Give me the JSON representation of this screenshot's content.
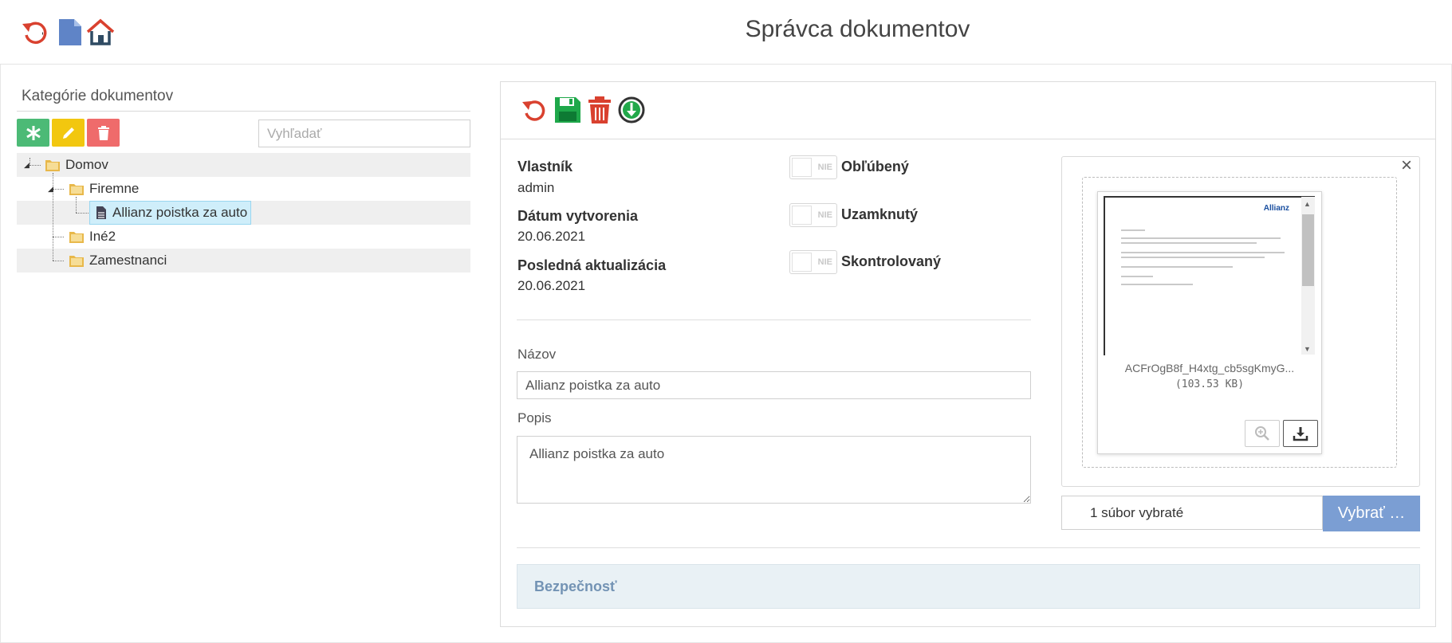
{
  "header": {
    "title": "Správca dokumentov",
    "icons": [
      "refresh-icon",
      "document-icon",
      "home-icon"
    ]
  },
  "categories": {
    "title": "Kategórie dokumentov",
    "search_placeholder": "Vyhľadať",
    "buttons": [
      "add-category-button",
      "edit-category-button",
      "delete-category-button"
    ],
    "tree": [
      {
        "label": "Domov",
        "level": 0,
        "type": "folder"
      },
      {
        "label": "Firemne",
        "level": 1,
        "type": "folder"
      },
      {
        "label": "Allianz poistka za auto",
        "level": 2,
        "type": "document",
        "selected": true
      },
      {
        "label": "Iné2",
        "level": 1,
        "type": "folder"
      },
      {
        "label": "Zamestnanci",
        "level": 1,
        "type": "folder"
      }
    ]
  },
  "toolbar": {
    "icons": [
      "reset-icon",
      "save-icon",
      "trash-icon",
      "download-icon"
    ]
  },
  "details": {
    "owner_label": "Vlastník",
    "owner_value": "admin",
    "created_label": "Dátum vytvorenia",
    "created_value": "20.06.2021",
    "updated_label": "Posledná aktualizácia",
    "updated_value": "20.06.2021"
  },
  "toggles": [
    {
      "state": "NIE",
      "label": "Obľúbený"
    },
    {
      "state": "NIE",
      "label": "Uzamknutý"
    },
    {
      "state": "NIE",
      "label": "Skontrolovaný"
    }
  ],
  "form": {
    "name_label": "Názov",
    "name_value": "Allianz poistka za auto",
    "desc_label": "Popis",
    "desc_value": "Allianz poistka za auto"
  },
  "file": {
    "brand": "Allianz",
    "name": "ACFrOgB8f_H4xtg_cb5sgKmyG...",
    "size": "(103.53 KB)",
    "caption": "1 súbor vybraté",
    "pick_label": "Vybrať …",
    "close_label": "×"
  },
  "security": {
    "label": "Bezpečnosť"
  },
  "colors": {
    "green": "#4cba76",
    "yellow": "#f2c70f",
    "red": "#ef6b6b",
    "save_green": "#1ea84a",
    "download_green": "#22a84a",
    "blue_button": "#7b9ed3",
    "folder": "#e8b84a"
  }
}
